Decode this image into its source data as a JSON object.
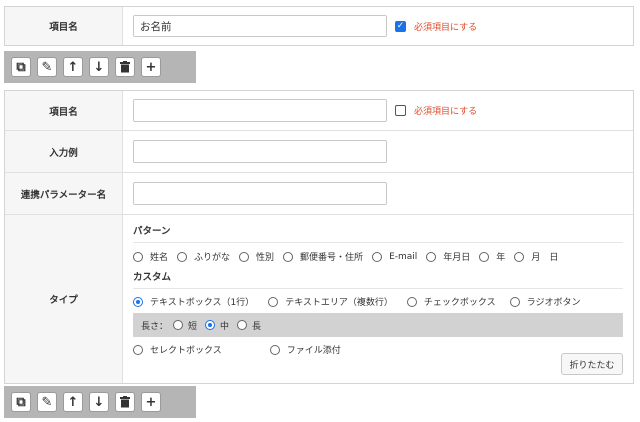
{
  "panel1": {
    "label": "項目名",
    "input_value": "お名前",
    "required_checked": true,
    "required_label": "必須項目にする"
  },
  "toolbar": {
    "copy_icon": "copy-icon",
    "edit_icon": "pencil-icon",
    "up_icon": "arrow-up-icon",
    "down_icon": "arrow-down-icon",
    "delete_icon": "trash-icon",
    "add_icon": "plus-icon"
  },
  "panel2": {
    "name_label": "項目名",
    "name_value": "",
    "required_checked": false,
    "required_label": "必須項目にする",
    "example_label": "入力例",
    "example_value": "",
    "param_label": "連携パラメーター名",
    "param_value": "",
    "type_label": "タイプ",
    "pattern_title": "パターン",
    "pattern_options": [
      "姓名",
      "ふりがな",
      "性別",
      "郵便番号・住所",
      "E-mail",
      "年月日",
      "年",
      "月",
      "日"
    ],
    "custom_title": "カスタム",
    "custom_row1": [
      "テキストボックス（1行）",
      "テキストエリア（複数行）",
      "チェックボックス",
      "ラジオボタン"
    ],
    "custom_row1_selected": 0,
    "length_label": "長さ：",
    "length_options": [
      "短",
      "中",
      "長"
    ],
    "length_selected": 1,
    "custom_row2": [
      "セレクトボックス",
      "ファイル添付"
    ],
    "fold_button": "折りたたむ"
  }
}
